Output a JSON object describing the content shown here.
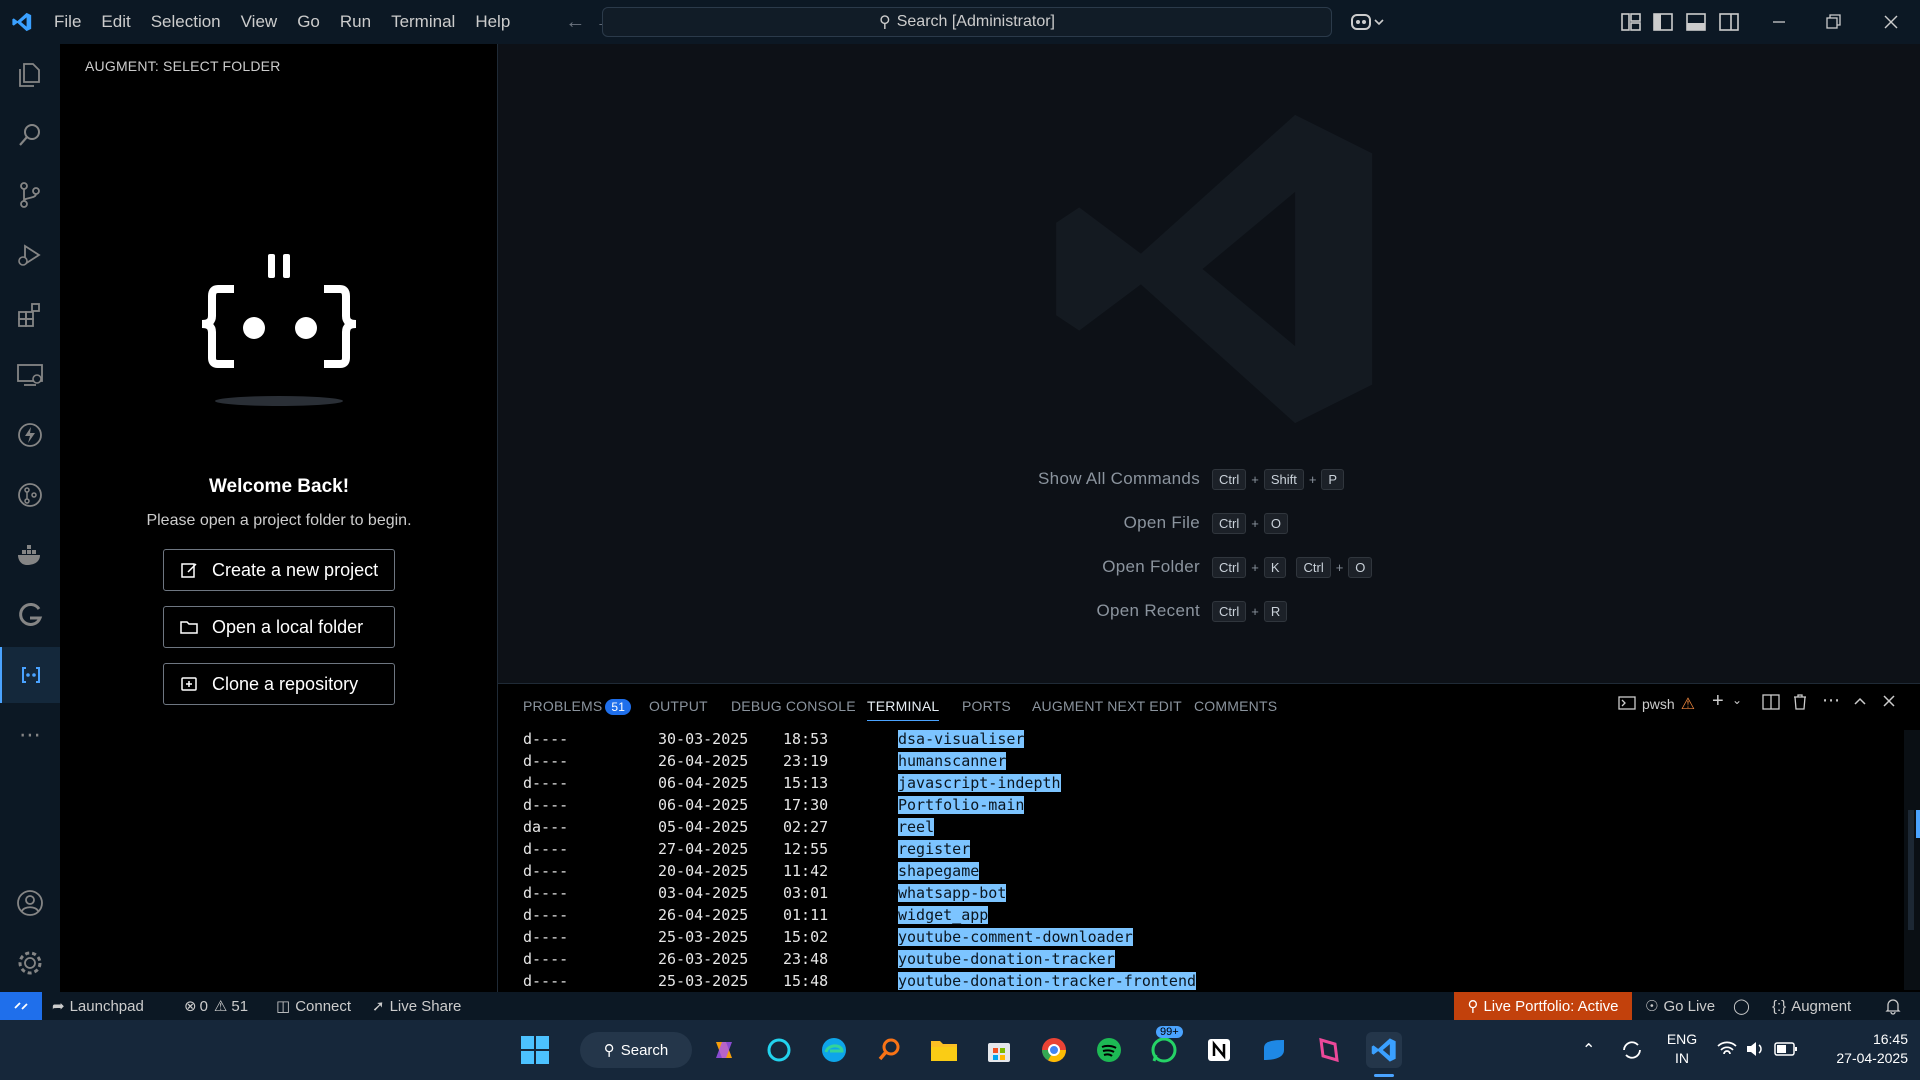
{
  "menu": [
    "File",
    "Edit",
    "Selection",
    "View",
    "Go",
    "Run",
    "Terminal",
    "Help"
  ],
  "search": {
    "label": "Search [Administrator]"
  },
  "sidebar": {
    "title": "AUGMENT: SELECT FOLDER",
    "welcome": "Welcome Back!",
    "subtitle": "Please open a project folder to begin.",
    "buttons": [
      "Create a new project",
      "Open a local folder",
      "Clone a repository"
    ]
  },
  "editor": {
    "commands": [
      {
        "label": "Show All Commands",
        "keys": [
          "Ctrl",
          "Shift",
          "P"
        ]
      },
      {
        "label": "Open File",
        "keys": [
          "Ctrl",
          "O"
        ]
      },
      {
        "label": "Open Folder",
        "keys": [
          "Ctrl",
          "K"
        ],
        "keys2": [
          "Ctrl",
          "O"
        ]
      },
      {
        "label": "Open Recent",
        "keys": [
          "Ctrl",
          "R"
        ]
      }
    ]
  },
  "panel": {
    "tabs": [
      "PROBLEMS",
      "OUTPUT",
      "DEBUG CONSOLE",
      "TERMINAL",
      "PORTS",
      "AUGMENT NEXT EDIT",
      "COMMENTS"
    ],
    "problems_count": "51",
    "shell": "pwsh",
    "terminal_rows": [
      {
        "mode": "d----",
        "date": "30-03-2025",
        "time": "18:53",
        "name": "dsa-visualiser"
      },
      {
        "mode": "d----",
        "date": "26-04-2025",
        "time": "23:19",
        "name": "humanscanner"
      },
      {
        "mode": "d----",
        "date": "06-04-2025",
        "time": "15:13",
        "name": "javascript-indepth"
      },
      {
        "mode": "d----",
        "date": "06-04-2025",
        "time": "17:30",
        "name": "Portfolio-main"
      },
      {
        "mode": "da---",
        "date": "05-04-2025",
        "time": "02:27",
        "name": "reel"
      },
      {
        "mode": "d----",
        "date": "27-04-2025",
        "time": "12:55",
        "name": "register"
      },
      {
        "mode": "d----",
        "date": "20-04-2025",
        "time": "11:42",
        "name": "shapegame"
      },
      {
        "mode": "d----",
        "date": "03-04-2025",
        "time": "03:01",
        "name": "whatsapp-bot"
      },
      {
        "mode": "d----",
        "date": "26-04-2025",
        "time": "01:11",
        "name": "widget_app"
      },
      {
        "mode": "d----",
        "date": "25-03-2025",
        "time": "15:02",
        "name": "youtube-comment-downloader"
      },
      {
        "mode": "d----",
        "date": "26-03-2025",
        "time": "23:48",
        "name": "youtube-donation-tracker"
      },
      {
        "mode": "d----",
        "date": "25-03-2025",
        "time": "15:48",
        "name": "youtube-donation-tracker-frontend"
      }
    ]
  },
  "statusbar": {
    "launchpad": "Launchpad",
    "errors": "0",
    "warnings": "51",
    "connect": "Connect",
    "live_share": "Live Share",
    "live_portfolio": "Live Portfolio: Active",
    "go_live": "Go Live",
    "augment": "Augment"
  },
  "taskbar": {
    "search": "Search",
    "badge": "99+",
    "lang1": "ENG",
    "lang2": "IN",
    "time": "16:45",
    "date": "27-04-2025"
  },
  "colors": {
    "accent": "#4aa3ff",
    "selection": "#7cc4ff",
    "status_live": "#c2410c"
  }
}
